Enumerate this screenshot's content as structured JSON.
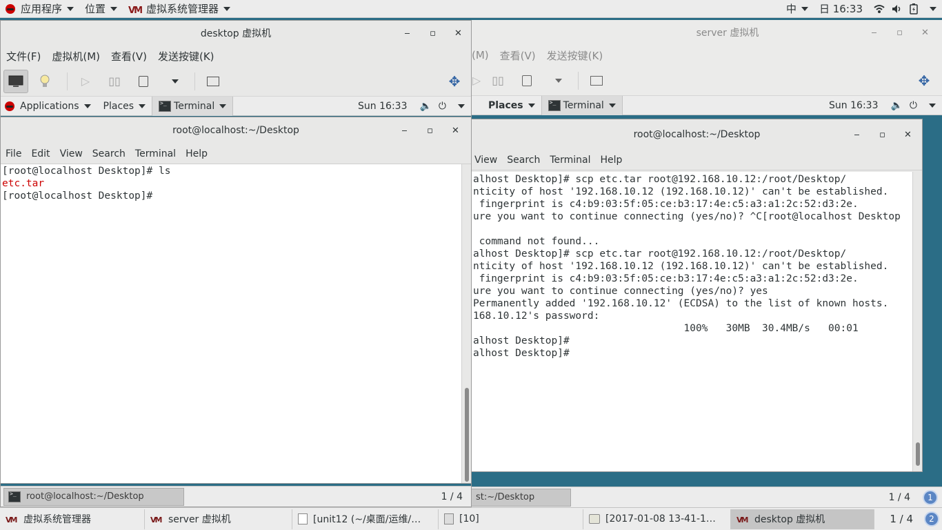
{
  "host_topbar": {
    "applications": "应用程序",
    "places": "位置",
    "current_app": "虚拟系统管理器",
    "input_method": "中",
    "clock": "日 16:33"
  },
  "desktop_vm": {
    "title": "desktop 虚拟机",
    "menu": [
      "文件(F)",
      "虚拟机(M)",
      "查看(V)",
      "发送按键(K)"
    ],
    "guest_panel": {
      "applications": "Applications",
      "places": "Places",
      "task": "Terminal",
      "clock": "Sun 16:33"
    },
    "terminal": {
      "title": "root@localhost:~/Desktop",
      "menu": [
        "File",
        "Edit",
        "View",
        "Search",
        "Terminal",
        "Help"
      ],
      "lines": [
        {
          "text": "[root@localhost Desktop]# ls",
          "color": "#2e3436"
        },
        {
          "text": "etc.tar",
          "color": "#cc0000"
        },
        {
          "text": "[root@localhost Desktop]# ",
          "color": "#2e3436"
        }
      ]
    },
    "bottom_task": "root@localhost:~/Desktop",
    "pager": "1 / 4"
  },
  "server_vm": {
    "title": "server 虚拟机",
    "menu": [
      "(M)",
      "查看(V)",
      "发送按键(K)"
    ],
    "guest_panel": {
      "places": "Places",
      "task": "Terminal",
      "clock": "Sun 16:33"
    },
    "terminal": {
      "title": "root@localhost:~/Desktop",
      "menu": [
        "View",
        "Search",
        "Terminal",
        "Help"
      ],
      "lines": [
        "alhost Desktop]# scp etc.tar root@192.168.10.12:/root/Desktop/",
        "nticity of host '192.168.10.12 (192.168.10.12)' can't be established.",
        " fingerprint is c4:b9:03:5f:05:ce:b3:17:4e:c5:a3:a1:2c:52:d3:2e.",
        "ure you want to continue connecting (yes/no)? ^C[root@localhost Desktop",
        "",
        " command not found...",
        "alhost Desktop]# scp etc.tar root@192.168.10.12:/root/Desktop/",
        "nticity of host '192.168.10.12 (192.168.10.12)' can't be established.",
        " fingerprint is c4:b9:03:5f:05:ce:b3:17:4e:c5:a3:a1:2c:52:d3:2e.",
        "ure you want to continue connecting (yes/no)? yes",
        "Permanently added '192.168.10.12' (ECDSA) to the list of known hosts.",
        "168.10.12's password:",
        "                                   100%   30MB  30.4MB/s   00:01",
        "alhost Desktop]# ",
        "alhost Desktop]# "
      ]
    },
    "bottom_task": "st:~/Desktop",
    "pager": "1 / 4",
    "workspace_badge": "1"
  },
  "host_taskbar": {
    "tasks": [
      {
        "label": "虚拟系统管理器",
        "icon": "vm-icon"
      },
      {
        "label": "server 虚拟机",
        "icon": "vm-icon"
      },
      {
        "label": "[unit12 (~/桌面/运维/…",
        "icon": "text-editor-icon"
      },
      {
        "label": "[10]",
        "icon": "document-icon"
      },
      {
        "label": "[2017-01-08 13-41-1…",
        "icon": "image-viewer-icon"
      },
      {
        "label": "desktop 虚拟机",
        "icon": "vm-icon"
      }
    ],
    "pager": "1 / 4",
    "workspace_badge": "2"
  },
  "colors": {
    "desktop_bg": "#2b6d86",
    "panel_bg": "#ececec",
    "terminal_red": "#cc0000"
  }
}
